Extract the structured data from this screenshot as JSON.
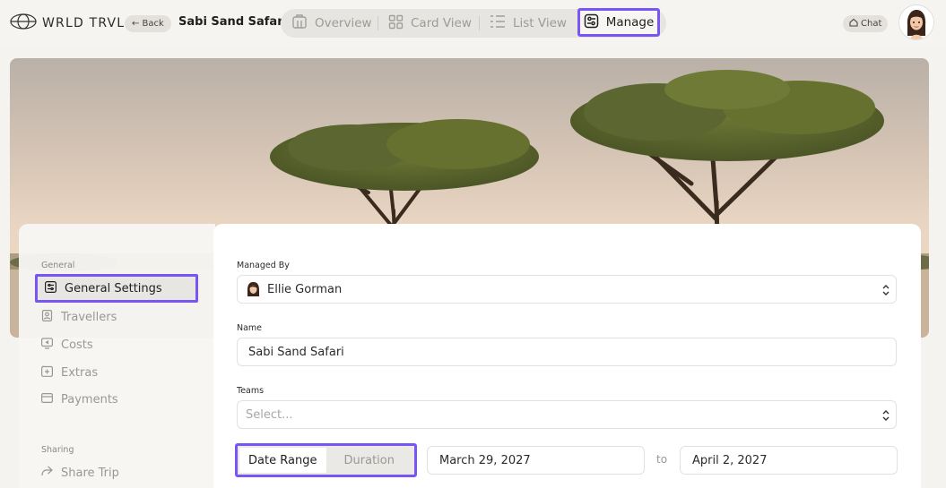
{
  "app": {
    "logo_text": "WRLD TRVL"
  },
  "header": {
    "back_label": "← Back",
    "trip_title": "Sabi Sand Safari",
    "nav": {
      "overview": "Overview",
      "card_view": "Card View",
      "list_view": "List View",
      "manage": "Manage"
    },
    "chat_label": "Chat"
  },
  "sidebar": {
    "section_general": "General",
    "items": {
      "general_settings": "General Settings",
      "travellers": "Travellers",
      "costs": "Costs",
      "extras": "Extras",
      "payments": "Payments"
    },
    "section_sharing": "Sharing",
    "share_trip": "Share Trip"
  },
  "form": {
    "managed_by_label": "Managed By",
    "managed_by_value": "Ellie Gorman",
    "name_label": "Name",
    "name_value": "Sabi Sand Safari",
    "teams_label": "Teams",
    "teams_placeholder": "Select...",
    "mode_date_range": "Date Range",
    "mode_duration": "Duration",
    "start_date": "March 29, 2027",
    "to_label": "to",
    "end_date": "April 2, 2027"
  },
  "colors": {
    "accent": "#7a55f5",
    "background": "#f4f3f0",
    "muted_text": "#9a9893"
  }
}
